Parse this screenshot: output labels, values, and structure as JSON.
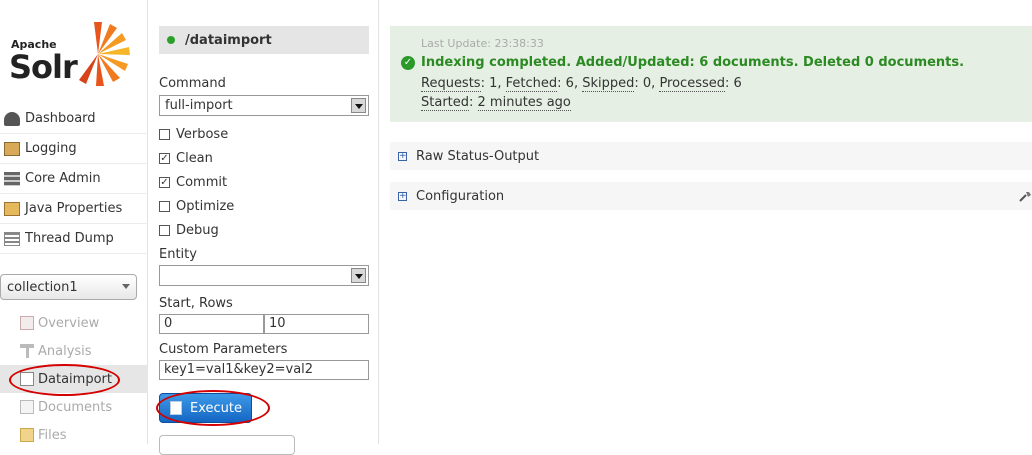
{
  "logo": {
    "apache": "Apache",
    "solr": "Solr"
  },
  "nav": [
    {
      "label": "Dashboard",
      "icon": "dashboard-icon"
    },
    {
      "label": "Logging",
      "icon": "logging-icon"
    },
    {
      "label": "Core Admin",
      "icon": "core-admin-icon"
    },
    {
      "label": "Java Properties",
      "icon": "java-properties-icon"
    },
    {
      "label": "Thread Dump",
      "icon": "thread-dump-icon"
    }
  ],
  "core_selector": {
    "value": "collection1"
  },
  "core_nav": [
    {
      "label": "Overview",
      "icon": "overview-icon"
    },
    {
      "label": "Analysis",
      "icon": "analysis-icon"
    },
    {
      "label": "Dataimport",
      "icon": "dataimport-icon",
      "active": true
    },
    {
      "label": "Documents",
      "icon": "documents-icon"
    },
    {
      "label": "Files",
      "icon": "files-icon"
    }
  ],
  "panel": {
    "handler": "/dataimport",
    "command_label": "Command",
    "command_value": "full-import",
    "options": [
      {
        "label": "Verbose",
        "checked": false
      },
      {
        "label": "Clean",
        "checked": true
      },
      {
        "label": "Commit",
        "checked": true
      },
      {
        "label": "Optimize",
        "checked": false
      },
      {
        "label": "Debug",
        "checked": false
      }
    ],
    "entity_label": "Entity",
    "entity_value": "",
    "start_rows_label": "Start, Rows",
    "start_value": "0",
    "rows_value": "10",
    "custom_params_label": "Custom Parameters",
    "custom_params_value": "key1=val1&key2=val2",
    "execute_label": "Execute"
  },
  "status": {
    "last_update": "Last Update: 23:38:33",
    "message": "Indexing completed. Added/Updated: 6 documents. Deleted 0 documents.",
    "requests_label": "Requests",
    "requests": "1",
    "fetched_label": "Fetched",
    "fetched": "6",
    "skipped_label": "Skipped",
    "skipped": "0",
    "processed_label": "Processed",
    "processed": "6",
    "started_label": "Started",
    "started": "2 minutes ago"
  },
  "sections": [
    {
      "label": "Raw Status-Output"
    },
    {
      "label": "Configuration"
    }
  ],
  "colors": {
    "success": "#2b8a22",
    "status_bg": "#e5efe3",
    "button": "#1f78d1",
    "highlight": "#d40000"
  }
}
